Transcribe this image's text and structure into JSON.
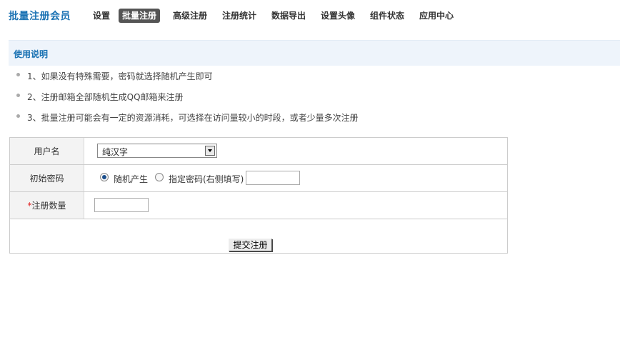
{
  "header": {
    "title": "批量注册会员",
    "tabs": [
      {
        "label": "设置",
        "active": false
      },
      {
        "label": "批量注册",
        "active": true
      },
      {
        "label": "高级注册",
        "active": false
      },
      {
        "label": "注册统计",
        "active": false
      },
      {
        "label": "数据导出",
        "active": false
      },
      {
        "label": "设置头像",
        "active": false
      },
      {
        "label": "组件状态",
        "active": false
      },
      {
        "label": "应用中心",
        "active": false
      }
    ]
  },
  "instructions": {
    "title": "使用说明",
    "items": [
      "1、如果没有特殊需要，密码就选择随机产生即可",
      "2、注册邮箱全部随机生成QQ邮箱来注册",
      "3、批量注册可能会有一定的资源消耗，可选择在访问量较小的时段，或者少量多次注册"
    ]
  },
  "form": {
    "username": {
      "label": "用户名",
      "selected_option": "纯汉字"
    },
    "password": {
      "label": "初始密码",
      "option_random": "随机产生",
      "option_custom": "指定密码(右侧填写)",
      "selected": "random",
      "custom_value": ""
    },
    "count": {
      "required_mark": "*",
      "label": "注册数量",
      "value": ""
    },
    "submit_label": "提交注册"
  },
  "colors": {
    "accent": "#1a72b3",
    "active_tab_bg": "#555555",
    "section_bg": "#eef4fb",
    "required": "#e02020"
  }
}
